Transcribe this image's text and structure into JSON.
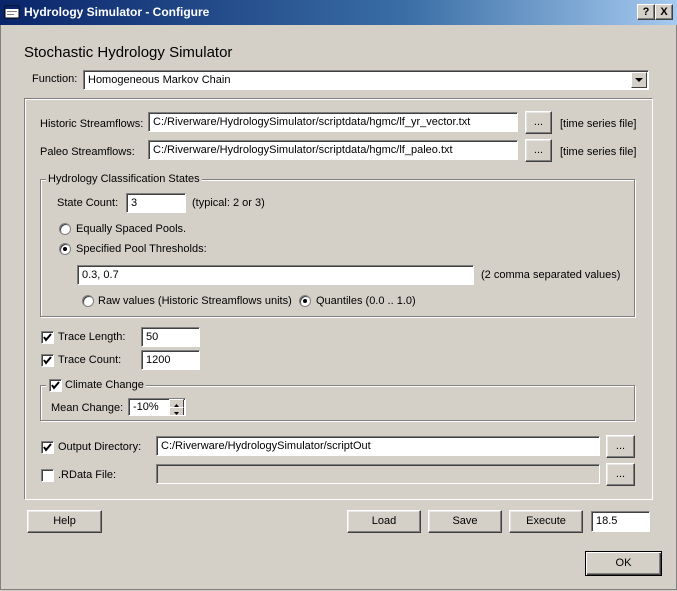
{
  "window": {
    "title": "Hydrology Simulator - Configure",
    "help_glyph": "?",
    "close_glyph": "X"
  },
  "app_title": "Stochastic Hydrology Simulator",
  "function": {
    "label": "Function:",
    "selected": "Homogeneous Markov Chain"
  },
  "historic": {
    "label": "Historic Streamflows:",
    "path": "C:/Riverware/HydrologySimulator/scriptdata/hgmc/lf_yr_vector.txt",
    "browse": "...",
    "hint": "[time series file]"
  },
  "paleo": {
    "label": "Paleo Streamflows:",
    "path": "C:/Riverware/HydrologySimulator/scriptdata/hgmc/lf_paleo.txt",
    "browse": "...",
    "hint": "[time series file]"
  },
  "states": {
    "title": "Hydrology Classification States",
    "count_label": "State Count:",
    "count": "3",
    "count_hint": "(typical: 2 or 3)",
    "equal_label": "Equally Spaced Pools.",
    "equal_selected": false,
    "specified_label": "Specified Pool Thresholds:",
    "specified_selected": true,
    "thresholds": "0.3, 0.7",
    "thresholds_hint": "(2 comma separated values)",
    "raw_label": "Raw values (Historic Streamflows units)",
    "raw_selected": false,
    "quantiles_label": "Quantiles (0.0 .. 1.0)",
    "quantiles_selected": true
  },
  "trace_length": {
    "label": "Trace Length:",
    "checked": true,
    "value": "50"
  },
  "trace_count": {
    "label": "Trace Count:",
    "checked": true,
    "value": "1200"
  },
  "climate": {
    "label": "Climate Change",
    "checked": true,
    "mean_label": "Mean Change:",
    "mean_value": "-10%"
  },
  "output_dir": {
    "label": "Output Directory:",
    "checked": true,
    "path": "C:/Riverware/HydrologySimulator/scriptOut",
    "browse": "..."
  },
  "rdata": {
    "label": ".RData File:",
    "checked": false,
    "path": "",
    "browse": "..."
  },
  "buttons": {
    "help": "Help",
    "load": "Load",
    "save": "Save",
    "execute": "Execute",
    "ok": "OK"
  },
  "execute_value": "18.5"
}
